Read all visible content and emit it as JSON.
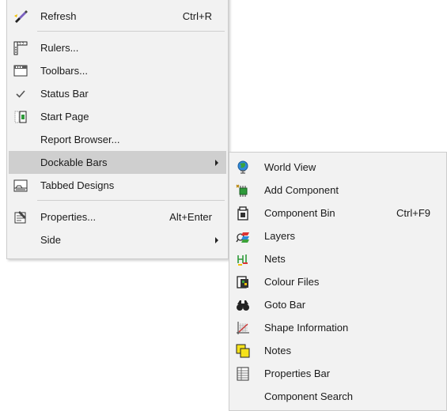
{
  "menu": {
    "items": [
      {
        "label": "Refresh",
        "shortcut": "Ctrl+R",
        "icon": "refresh-brush-icon"
      },
      {
        "label": "Rulers...",
        "shortcut": "",
        "icon": "rulers-icon"
      },
      {
        "label": "Toolbars...",
        "shortcut": "",
        "icon": "toolbars-icon"
      },
      {
        "label": "Status Bar",
        "shortcut": "",
        "icon": "checkmark-icon"
      },
      {
        "label": "Start Page",
        "shortcut": "",
        "icon": "start-page-icon"
      },
      {
        "label": "Report Browser...",
        "shortcut": "",
        "icon": ""
      },
      {
        "label": "Dockable Bars",
        "shortcut": "",
        "icon": "",
        "has_submenu": true,
        "highlighted": true
      },
      {
        "label": "Tabbed Designs",
        "shortcut": "",
        "icon": "tabbed-designs-icon"
      },
      {
        "label": "Properties...",
        "shortcut": "Alt+Enter",
        "icon": "properties-icon"
      },
      {
        "label": "Side",
        "shortcut": "",
        "icon": "",
        "has_submenu": true
      }
    ]
  },
  "submenu": {
    "items": [
      {
        "label": "World View",
        "shortcut": "",
        "icon": "globe-icon"
      },
      {
        "label": "Add Component",
        "shortcut": "",
        "icon": "add-component-icon"
      },
      {
        "label": "Component Bin",
        "shortcut": "Ctrl+F9",
        "icon": "component-bin-icon"
      },
      {
        "label": "Layers",
        "shortcut": "",
        "icon": "layers-icon"
      },
      {
        "label": "Nets",
        "shortcut": "",
        "icon": "nets-icon"
      },
      {
        "label": "Colour Files",
        "shortcut": "",
        "icon": "colour-files-icon"
      },
      {
        "label": "Goto Bar",
        "shortcut": "",
        "icon": "binoculars-icon"
      },
      {
        "label": "Shape Information",
        "shortcut": "",
        "icon": "shape-information-icon"
      },
      {
        "label": "Notes",
        "shortcut": "",
        "icon": "notes-icon"
      },
      {
        "label": "Properties Bar",
        "shortcut": "",
        "icon": "properties-bar-icon"
      },
      {
        "label": "Component Search",
        "shortcut": "",
        "icon": ""
      }
    ]
  },
  "colors": {
    "menu_background": "#f2f2f2",
    "highlight": "#cfcfcf",
    "text": "#1a1a1a"
  }
}
